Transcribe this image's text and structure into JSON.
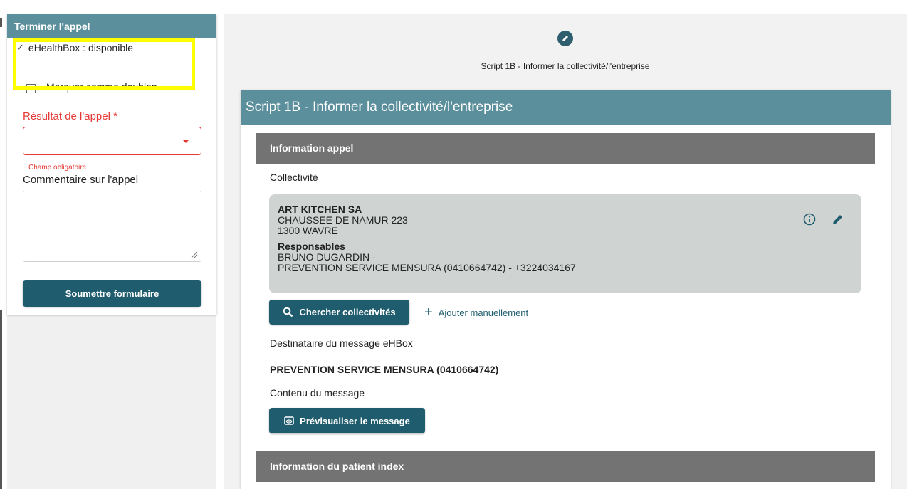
{
  "left_panel": {
    "header": "Terminer l'appel",
    "ehealthbox_status": "eHealthBox : disponible",
    "mark_duplicate_label": "Marquer comme doublon",
    "result_label": "Résultat de l'appel *",
    "result_value": "",
    "required_hint": "Champ obligatoire",
    "comment_label": "Commentaire sur l'appel",
    "comment_value": "",
    "submit_label": "Soumettre formulaire"
  },
  "main": {
    "script_subtitle": "Script 1B - Informer la collectivité/l'entreprise",
    "card_title": "Script 1B - Informer la collectivité/l'entreprise",
    "section_call_info": "Information appel",
    "collectivite_label": "Collectivité",
    "collectivite": {
      "name": "ART KITCHEN SA",
      "street": "CHAUSSEE DE NAMUR 223",
      "city": "1300 WAVRE",
      "responsables_label": "Responsables",
      "responsable_1": "BRUNO DUGARDIN -",
      "responsable_2": "PREVENTION SERVICE MENSURA (0410664742) - +3224034167"
    },
    "search_button": "Chercher collectivités",
    "add_manual": "Ajouter manuellement",
    "recipient_label": "Destinataire du message eHBox",
    "recipient_value": "PREVENTION SERVICE MENSURA (0410664742)",
    "message_content_label": "Contenu du message",
    "preview_button": "Prévisualiser le message",
    "section_patient_index": "Information du patient index"
  },
  "icons": [
    "check-icon",
    "checkbox",
    "caret-down-icon",
    "resize-grip-icon",
    "pencil-icon",
    "info-icon",
    "edit-icon",
    "search-icon",
    "plus-icon",
    "preview-icon"
  ],
  "colors": {
    "header_teal": "#5c8f9c",
    "button_dark_teal": "#1f5d6e",
    "error_red": "#e53935",
    "section_gray": "#737373",
    "highlight_yellow": "#ffff00",
    "card_gray": "#cfd4d3"
  }
}
